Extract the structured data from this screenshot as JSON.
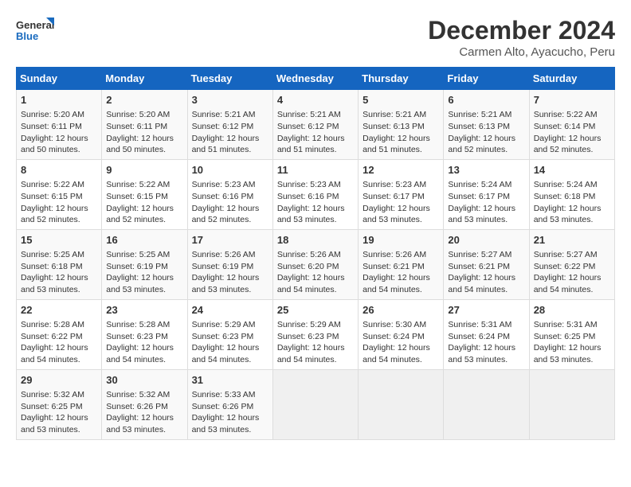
{
  "logo": {
    "line1": "General",
    "line2": "Blue"
  },
  "title": "December 2024",
  "subtitle": "Carmen Alto, Ayacucho, Peru",
  "days_of_week": [
    "Sunday",
    "Monday",
    "Tuesday",
    "Wednesday",
    "Thursday",
    "Friday",
    "Saturday"
  ],
  "weeks": [
    [
      {
        "day": 1,
        "lines": [
          "Sunrise: 5:20 AM",
          "Sunset: 6:11 PM",
          "Daylight: 12 hours",
          "and 50 minutes."
        ]
      },
      {
        "day": 2,
        "lines": [
          "Sunrise: 5:20 AM",
          "Sunset: 6:11 PM",
          "Daylight: 12 hours",
          "and 50 minutes."
        ]
      },
      {
        "day": 3,
        "lines": [
          "Sunrise: 5:21 AM",
          "Sunset: 6:12 PM",
          "Daylight: 12 hours",
          "and 51 minutes."
        ]
      },
      {
        "day": 4,
        "lines": [
          "Sunrise: 5:21 AM",
          "Sunset: 6:12 PM",
          "Daylight: 12 hours",
          "and 51 minutes."
        ]
      },
      {
        "day": 5,
        "lines": [
          "Sunrise: 5:21 AM",
          "Sunset: 6:13 PM",
          "Daylight: 12 hours",
          "and 51 minutes."
        ]
      },
      {
        "day": 6,
        "lines": [
          "Sunrise: 5:21 AM",
          "Sunset: 6:13 PM",
          "Daylight: 12 hours",
          "and 52 minutes."
        ]
      },
      {
        "day": 7,
        "lines": [
          "Sunrise: 5:22 AM",
          "Sunset: 6:14 PM",
          "Daylight: 12 hours",
          "and 52 minutes."
        ]
      }
    ],
    [
      {
        "day": 8,
        "lines": [
          "Sunrise: 5:22 AM",
          "Sunset: 6:15 PM",
          "Daylight: 12 hours",
          "and 52 minutes."
        ]
      },
      {
        "day": 9,
        "lines": [
          "Sunrise: 5:22 AM",
          "Sunset: 6:15 PM",
          "Daylight: 12 hours",
          "and 52 minutes."
        ]
      },
      {
        "day": 10,
        "lines": [
          "Sunrise: 5:23 AM",
          "Sunset: 6:16 PM",
          "Daylight: 12 hours",
          "and 52 minutes."
        ]
      },
      {
        "day": 11,
        "lines": [
          "Sunrise: 5:23 AM",
          "Sunset: 6:16 PM",
          "Daylight: 12 hours",
          "and 53 minutes."
        ]
      },
      {
        "day": 12,
        "lines": [
          "Sunrise: 5:23 AM",
          "Sunset: 6:17 PM",
          "Daylight: 12 hours",
          "and 53 minutes."
        ]
      },
      {
        "day": 13,
        "lines": [
          "Sunrise: 5:24 AM",
          "Sunset: 6:17 PM",
          "Daylight: 12 hours",
          "and 53 minutes."
        ]
      },
      {
        "day": 14,
        "lines": [
          "Sunrise: 5:24 AM",
          "Sunset: 6:18 PM",
          "Daylight: 12 hours",
          "and 53 minutes."
        ]
      }
    ],
    [
      {
        "day": 15,
        "lines": [
          "Sunrise: 5:25 AM",
          "Sunset: 6:18 PM",
          "Daylight: 12 hours",
          "and 53 minutes."
        ]
      },
      {
        "day": 16,
        "lines": [
          "Sunrise: 5:25 AM",
          "Sunset: 6:19 PM",
          "Daylight: 12 hours",
          "and 53 minutes."
        ]
      },
      {
        "day": 17,
        "lines": [
          "Sunrise: 5:26 AM",
          "Sunset: 6:19 PM",
          "Daylight: 12 hours",
          "and 53 minutes."
        ]
      },
      {
        "day": 18,
        "lines": [
          "Sunrise: 5:26 AM",
          "Sunset: 6:20 PM",
          "Daylight: 12 hours",
          "and 54 minutes."
        ]
      },
      {
        "day": 19,
        "lines": [
          "Sunrise: 5:26 AM",
          "Sunset: 6:21 PM",
          "Daylight: 12 hours",
          "and 54 minutes."
        ]
      },
      {
        "day": 20,
        "lines": [
          "Sunrise: 5:27 AM",
          "Sunset: 6:21 PM",
          "Daylight: 12 hours",
          "and 54 minutes."
        ]
      },
      {
        "day": 21,
        "lines": [
          "Sunrise: 5:27 AM",
          "Sunset: 6:22 PM",
          "Daylight: 12 hours",
          "and 54 minutes."
        ]
      }
    ],
    [
      {
        "day": 22,
        "lines": [
          "Sunrise: 5:28 AM",
          "Sunset: 6:22 PM",
          "Daylight: 12 hours",
          "and 54 minutes."
        ]
      },
      {
        "day": 23,
        "lines": [
          "Sunrise: 5:28 AM",
          "Sunset: 6:23 PM",
          "Daylight: 12 hours",
          "and 54 minutes."
        ]
      },
      {
        "day": 24,
        "lines": [
          "Sunrise: 5:29 AM",
          "Sunset: 6:23 PM",
          "Daylight: 12 hours",
          "and 54 minutes."
        ]
      },
      {
        "day": 25,
        "lines": [
          "Sunrise: 5:29 AM",
          "Sunset: 6:23 PM",
          "Daylight: 12 hours",
          "and 54 minutes."
        ]
      },
      {
        "day": 26,
        "lines": [
          "Sunrise: 5:30 AM",
          "Sunset: 6:24 PM",
          "Daylight: 12 hours",
          "and 54 minutes."
        ]
      },
      {
        "day": 27,
        "lines": [
          "Sunrise: 5:31 AM",
          "Sunset: 6:24 PM",
          "Daylight: 12 hours",
          "and 53 minutes."
        ]
      },
      {
        "day": 28,
        "lines": [
          "Sunrise: 5:31 AM",
          "Sunset: 6:25 PM",
          "Daylight: 12 hours",
          "and 53 minutes."
        ]
      }
    ],
    [
      {
        "day": 29,
        "lines": [
          "Sunrise: 5:32 AM",
          "Sunset: 6:25 PM",
          "Daylight: 12 hours",
          "and 53 minutes."
        ]
      },
      {
        "day": 30,
        "lines": [
          "Sunrise: 5:32 AM",
          "Sunset: 6:26 PM",
          "Daylight: 12 hours",
          "and 53 minutes."
        ]
      },
      {
        "day": 31,
        "lines": [
          "Sunrise: 5:33 AM",
          "Sunset: 6:26 PM",
          "Daylight: 12 hours",
          "and 53 minutes."
        ]
      },
      null,
      null,
      null,
      null
    ]
  ]
}
